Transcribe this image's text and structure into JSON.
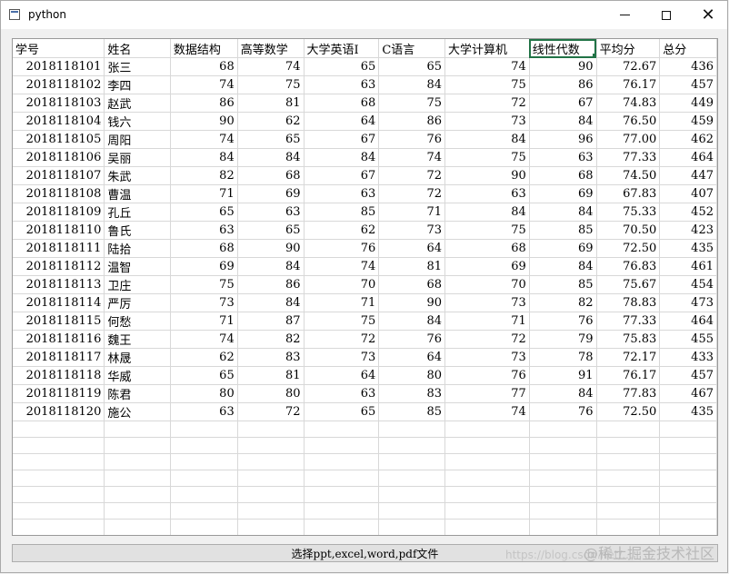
{
  "window": {
    "title": "python"
  },
  "table": {
    "columns": [
      "学号",
      "姓名",
      "数据结构",
      "高等数学",
      "大学英语I",
      "C语言",
      "大学计算机",
      "线性代数",
      "平均分",
      "总分"
    ],
    "rows": [
      [
        "2018118101",
        "张三",
        "68",
        "74",
        "65",
        "65",
        "74",
        "90",
        "72.67",
        "436"
      ],
      [
        "2018118102",
        "李四",
        "74",
        "75",
        "63",
        "84",
        "75",
        "86",
        "76.17",
        "457"
      ],
      [
        "2018118103",
        "赵武",
        "86",
        "81",
        "68",
        "75",
        "72",
        "67",
        "74.83",
        "449"
      ],
      [
        "2018118104",
        "钱六",
        "90",
        "62",
        "64",
        "86",
        "73",
        "84",
        "76.50",
        "459"
      ],
      [
        "2018118105",
        "周阳",
        "74",
        "65",
        "67",
        "76",
        "84",
        "96",
        "77.00",
        "462"
      ],
      [
        "2018118106",
        "吴丽",
        "84",
        "84",
        "84",
        "74",
        "75",
        "63",
        "77.33",
        "464"
      ],
      [
        "2018118107",
        "朱武",
        "82",
        "68",
        "67",
        "72",
        "90",
        "68",
        "74.50",
        "447"
      ],
      [
        "2018118108",
        "曹温",
        "71",
        "69",
        "63",
        "72",
        "63",
        "69",
        "67.83",
        "407"
      ],
      [
        "2018118109",
        "孔丘",
        "65",
        "63",
        "85",
        "71",
        "84",
        "84",
        "75.33",
        "452"
      ],
      [
        "2018118110",
        "鲁氏",
        "63",
        "65",
        "62",
        "73",
        "75",
        "85",
        "70.50",
        "423"
      ],
      [
        "2018118111",
        "陆拾",
        "68",
        "90",
        "76",
        "64",
        "68",
        "69",
        "72.50",
        "435"
      ],
      [
        "2018118112",
        "温智",
        "69",
        "84",
        "74",
        "81",
        "69",
        "84",
        "76.83",
        "461"
      ],
      [
        "2018118113",
        "卫庄",
        "75",
        "86",
        "70",
        "68",
        "70",
        "85",
        "75.67",
        "454"
      ],
      [
        "2018118114",
        "严厉",
        "73",
        "84",
        "71",
        "90",
        "73",
        "82",
        "78.83",
        "473"
      ],
      [
        "2018118115",
        "何愁",
        "71",
        "87",
        "75",
        "84",
        "71",
        "76",
        "77.33",
        "464"
      ],
      [
        "2018118116",
        "魏王",
        "74",
        "82",
        "72",
        "76",
        "72",
        "79",
        "75.83",
        "455"
      ],
      [
        "2018118117",
        "林晟",
        "62",
        "83",
        "73",
        "64",
        "73",
        "78",
        "72.17",
        "433"
      ],
      [
        "2018118118",
        "华威",
        "65",
        "81",
        "64",
        "80",
        "76",
        "91",
        "76.17",
        "457"
      ],
      [
        "2018118119",
        "陈君",
        "80",
        "80",
        "63",
        "83",
        "77",
        "84",
        "77.83",
        "467"
      ],
      [
        "2018118120",
        "施公",
        "63",
        "72",
        "65",
        "85",
        "74",
        "76",
        "72.50",
        "435"
      ]
    ],
    "selected_header": "线性代数"
  },
  "button": {
    "label": "选择ppt,excel,word,pdf文件"
  },
  "watermark": {
    "text": "@稀土掘金技术社区",
    "url_text": "https://blog.csdn.net/..."
  }
}
